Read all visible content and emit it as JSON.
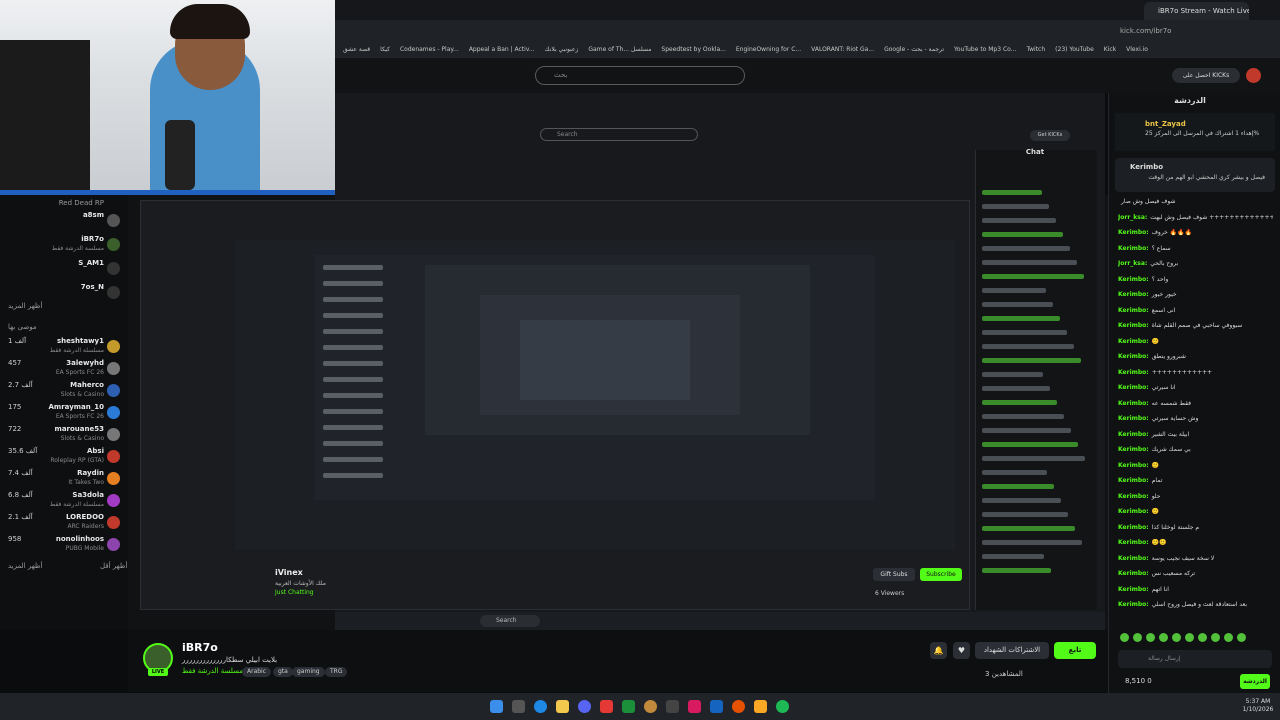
{
  "browser": {
    "active_tab": "iBR7o Stream - Watch Live on Kick",
    "url": "kick.com/ibr7o",
    "bookmarks": [
      "قصة عشق",
      "كيكا",
      "Codenames - Play...",
      "Appeal a Ban | Activ...",
      "زعبونبي بلانك",
      "Game of Th... مسلسل",
      "Speedtest by Ookla...",
      "EngineOwning for C...",
      "VALORANT: Riot Ga...",
      "Google - ترجمة - بحث",
      "YouTube to Mp3 Co...",
      "Twitch",
      "(23) YouTube",
      "Kick",
      "Vlexi.io"
    ]
  },
  "topbar": {
    "search_placeholder": "بحث",
    "get_kicks": "احصل على KICKs"
  },
  "sidebar": {
    "top_item": "Red Dead RP",
    "channels": [
      {
        "name": "a8sm",
        "sub": "",
        "count": ""
      },
      {
        "name": "iBR7o",
        "sub": "مسلسة الدرشة فقط",
        "count": ""
      },
      {
        "name": "S_AM1",
        "sub": "",
        "count": ""
      },
      {
        "name": "7os_N",
        "sub": "",
        "count": ""
      }
    ],
    "show_more_1": "أظهر المزيد",
    "recommended_header": "موصى بها",
    "recommended": [
      {
        "name": "sheshtawy1",
        "sub": "مسلسلة الدرشة فقط",
        "count": "1 آلف"
      },
      {
        "name": "3alewyhd",
        "sub": "EA Sports FC 26",
        "count": "457"
      },
      {
        "name": "Mahercο",
        "sub": "Slots & Casino",
        "count": "2.7 آلف"
      },
      {
        "name": "Amrayman_10",
        "sub": "EA Sports FC 26",
        "count": "175"
      },
      {
        "name": "marouane53",
        "sub": "Slots & Casino",
        "count": "722"
      },
      {
        "name": "Absi",
        "sub": "Roleplay RP (GTA)",
        "count": "35.6 آلف"
      },
      {
        "name": "Raydin",
        "sub": "It Takes Two",
        "count": "7.4 آلف"
      },
      {
        "name": "Sa3dola",
        "sub": "مسلسلة الدرشة فقط",
        "count": "6.8 آلف"
      },
      {
        "name": "LOREDOO",
        "sub": "ARC Raiders",
        "count": "2.1 آلف"
      },
      {
        "name": "nonolinhoos",
        "sub": "PUBG Mobile",
        "count": "958"
      }
    ],
    "show_more_2": "أظهر المزيد",
    "show_less": "أظهر أقل"
  },
  "inner_stream": {
    "search": "Search",
    "get_kicks": "Get KICKs",
    "chat_title": "Chat",
    "streamer_name": "iVinex",
    "streamer_title": "ملك الأوشات العربية",
    "streamer_category": "Just Chatting",
    "gift_subs": "Gift Subs",
    "subscribe": "Subscribe",
    "viewers": "6 Viewers",
    "taskbar_search": "Search"
  },
  "main_stream": {
    "name": "iBR7o",
    "title": "بلايت ابيلي سطكاررررررررررررر",
    "category": "مسلسة الدرشة فقط",
    "live": "LIVE",
    "tags": [
      "Arabic",
      "gta",
      "gaming",
      "TRG"
    ],
    "follow": "تابع",
    "subscriptions": "الاشتراكات الشهداد",
    "viewers": "المشاهدين 3"
  },
  "chat": {
    "title": "الدردشة",
    "pinned_user": "bnt_Zayad",
    "pinned_text": "إهداء 1 اشتراك في المرسل الى المركز 25%",
    "pinned2_user": "Kerimbo",
    "pinned2_text": "فيصل و بيشر كري المحشي ابو الهم من الوقت",
    "messages": [
      {
        "user": "",
        "msg": "شوف فيصل وش صار"
      },
      {
        "user": "Jorr_ksa:",
        "msg": "شوف فيصل وش لبهت ++++++++++++++"
      },
      {
        "user": "Kerimbo:",
        "msg": "خروف 🔥🔥🔥"
      },
      {
        "user": "Kerimbo:",
        "msg": "سماع ؟"
      },
      {
        "user": "Jorr_ksa:",
        "msg": "بروح بالحي"
      },
      {
        "user": "Kerimbo:",
        "msg": "واحد ؟"
      },
      {
        "user": "Kerimbo:",
        "msg": "خيور خيور"
      },
      {
        "user": "Kerimbo:",
        "msg": "انى اسمع"
      },
      {
        "user": "Kerimbo:",
        "msg": "سيووفي ساحبي في صمم القلم شاة"
      },
      {
        "user": "Kerimbo:",
        "msg": "🙂"
      },
      {
        "user": "Kerimbo:",
        "msg": "شبرورو ينطق"
      },
      {
        "user": "Kerimbo:",
        "msg": "++++++++++++"
      },
      {
        "user": "Kerimbo:",
        "msg": "انا سيرتي"
      },
      {
        "user": "Kerimbo:",
        "msg": "فقط شمسه عه"
      },
      {
        "user": "Kerimbo:",
        "msg": "وش حساية سيرتي"
      },
      {
        "user": "Kerimbo:",
        "msg": "ابيلة بيث الشير"
      },
      {
        "user": "Kerimbo:",
        "msg": "بي سمك شريك"
      },
      {
        "user": "Kerimbo:",
        "msg": "🙂"
      },
      {
        "user": "Kerimbo:",
        "msg": "تمام"
      },
      {
        "user": "Kerimbo:",
        "msg": "حلو"
      },
      {
        "user": "Kerimbo:",
        "msg": "🙂"
      },
      {
        "user": "Kerimbo:",
        "msg": "م جلستة لوخلنا كذا"
      },
      {
        "user": "Kerimbo:",
        "msg": "🙂🙂"
      },
      {
        "user": "Kerimbo:",
        "msg": "لا سخة سيف نجيب يوسة"
      },
      {
        "user": "Kerimbo:",
        "msg": "تركه مسعيب نس"
      },
      {
        "user": "Kerimbo:",
        "msg": "انا اتهم"
      },
      {
        "user": "Kerimbo:",
        "msg": "بعد استعادقة لعث و فيصل وروح اسلي"
      }
    ],
    "input_placeholder": "إرسال رسالة",
    "kicks": "8,510",
    "kicks_zero": "0",
    "send": "الدردشة"
  },
  "clock": {
    "time": "5:37 AM",
    "date": "1/10/2026"
  }
}
